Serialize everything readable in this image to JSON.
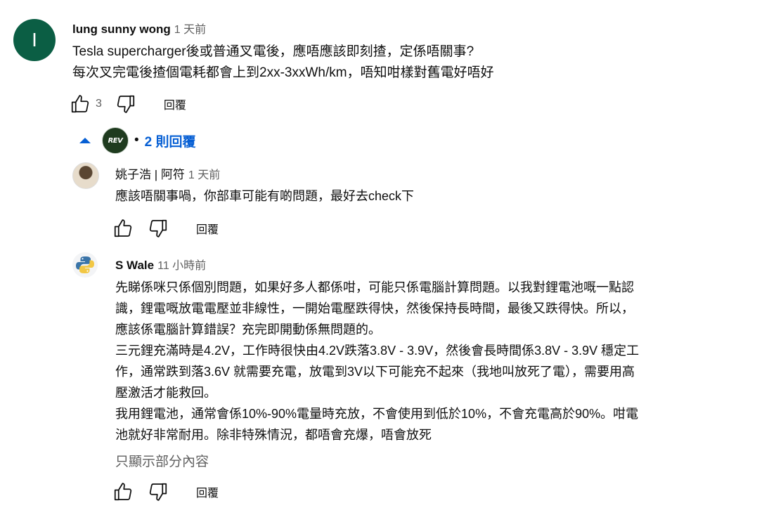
{
  "comment": {
    "avatar_letter": "I",
    "author": "lung sunny wong",
    "time": "1 天前",
    "lines": [
      "Tesla supercharger後或普通叉電後，應唔應該即刻揸，定係唔關事?",
      "每次叉完電後揸個電耗都會上到2xx-3xxWh/km，唔知咁樣對舊電好唔好"
    ],
    "likes": "3",
    "reply_label": "回覆"
  },
  "replies_toggle": {
    "logo_text": "REV",
    "bullet": "•",
    "count_label": "2 則回覆"
  },
  "replies": [
    {
      "author": "姚子浩 | 阿符",
      "time": "1 天前",
      "lines": [
        "應該唔關事喎，你部車可能有啲問題，最好去check下"
      ],
      "reply_label": "回覆"
    },
    {
      "author": "S Wale",
      "time": "11 小時前",
      "lines": [
        "先睇係咪只係個別問題，如果好多人都係咁，可能只係電腦計算問題。以我對鋰電池嘅一點認",
        "識，鋰電嘅放電電壓並非線性，一開始電壓跌得快，然後保持長時間，最後又跌得快。所以，",
        "應該係電腦計算錯誤？充完即開動係無問題的。",
        "三元鋰充滿時是4.2V，工作時很快由4.2V跌落3.8V - 3.9V，然後會長時間係3.8V - 3.9V 穩定工",
        "作，通常跌到落3.6V 就需要充電，放電到3V以下可能充不起來（我地叫放死了電），需要用高",
        "壓激活才能救回。",
        "我用鋰電池，通常會係10%-90%電量時充放，不會使用到低於10%，不會充電高於90%。咁電",
        "池就好非常耐用。除非特殊情況，都唔會充爆，唔會放死"
      ],
      "show_less_label": "只顯示部分內容",
      "reply_label": "回覆"
    }
  ],
  "colors": {
    "avatar_bg": "#0b5e44",
    "link_blue": "#065fd4",
    "secondary_text": "#606060"
  }
}
